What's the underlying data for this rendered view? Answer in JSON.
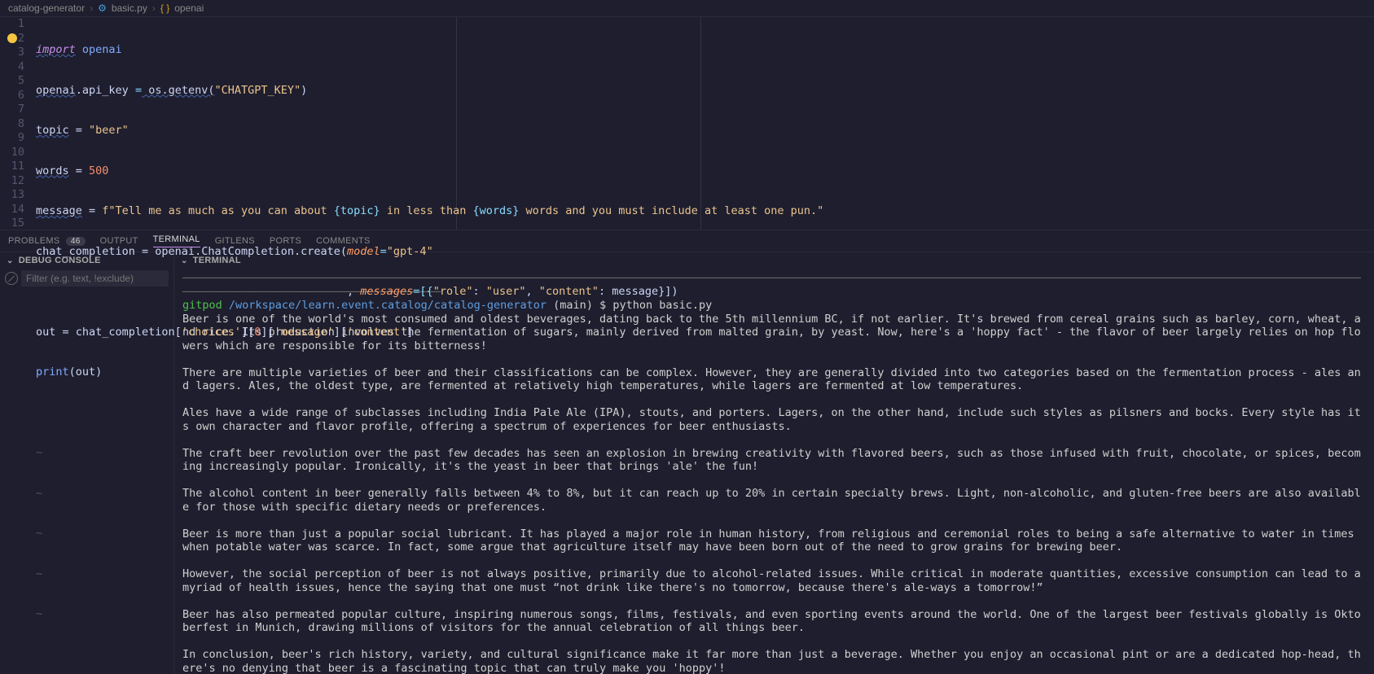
{
  "breadcrumb": {
    "folder": "catalog-generator",
    "file": "basic.py",
    "symbol": "openai"
  },
  "editor": {
    "lines": [
      "1",
      "2",
      "3",
      "4",
      "5",
      "6",
      "7",
      "8",
      "9",
      "10",
      "11",
      "12",
      "13",
      "14",
      "15"
    ],
    "code": {
      "l1_kw": "import",
      "l1_mod": "openai",
      "l2_a": "openai",
      "l2_b": ".api_key ",
      "l2_c": "=",
      "l2_d": " os.getenv(",
      "l2_e": "\"CHATGPT_KEY\"",
      "l2_f": ")",
      "l3_a": "topic",
      "l3_b": " = ",
      "l3_c": "\"beer\"",
      "l4_a": "words",
      "l4_b": " = ",
      "l4_c": "500",
      "l5_a": "message",
      "l5_b": " = ",
      "l5_c": "f\"Tell me as much as you can about ",
      "l5_d": "{topic}",
      "l5_e": " in less than ",
      "l5_f": "{words}",
      "l5_g": " words and you must include at least one pun.\"",
      "l6_a": "chat_completion = openai.ChatCompletion.create(",
      "l6_b": "model",
      "l6_c": "=",
      "l6_d": "\"gpt-4\"",
      "l7_a": "                                               , ",
      "l7_b": "messages",
      "l7_c": "=[{",
      "l7_d": "\"role\"",
      "l7_e": ": ",
      "l7_f": "\"user\"",
      "l7_g": ", ",
      "l7_h": "\"content\"",
      "l7_i": ": message}])",
      "l8": "out = chat_completion['choices'][0]['message']['content']",
      "l8_a": "out = chat_completion[",
      "l8_b": "'choices'",
      "l8_c": "][",
      "l8_d": "0",
      "l8_e": "][",
      "l8_f": "'message'",
      "l8_g": "][",
      "l8_h": "'content'",
      "l8_i": "]",
      "l9_a": "print",
      "l9_b": "(out)",
      "tilde": "~"
    }
  },
  "panel_tabs": {
    "problems": "PROBLEMS",
    "problems_count": "46",
    "output": "OUTPUT",
    "terminal": "TERMINAL",
    "gitlens": "GITLENS",
    "ports": "PORTS",
    "comments": "COMMENTS"
  },
  "debug_console": {
    "title": "DEBUG CONSOLE",
    "filter_placeholder": "Filter (e.g. text, !exclude)"
  },
  "terminal": {
    "title": "TERMINAL",
    "prompt_user": "gitpod",
    "prompt_path": " /workspace/learn.event.catalog/catalog-generator",
    "prompt_branch": " (main) $ ",
    "command": "python basic.py",
    "p1": "Beer is one of the world's most consumed and oldest beverages, dating back to the 5th millennium BC, if not earlier. It's brewed from cereal grains such as barley, corn, wheat, and rice. Its production involves the fermentation of sugars, mainly derived from malted grain, by yeast. Now, here's a 'hoppy fact' - the flavor of beer largely relies on hop flowers which are responsible for its bitterness!",
    "p2": "There are multiple varieties of beer and their classifications can be complex. However, they are generally divided into two categories based on the fermentation process - ales and lagers. Ales, the oldest type, are fermented at relatively high temperatures, while lagers are fermented at low temperatures.",
    "p3": "Ales have a wide range of subclasses including India Pale Ale (IPA), stouts, and porters. Lagers, on the other hand, include such styles as pilsners and bocks. Every style has its own character and flavor profile, offering a spectrum of experiences for beer enthusiasts.",
    "p4": "The craft beer revolution over the past few decades has seen an explosion in brewing creativity with flavored beers, such as those infused with fruit, chocolate, or spices, becoming increasingly popular. Ironically, it's the yeast in beer that brings 'ale' the fun!",
    "p5": "The alcohol content in beer generally falls between 4% to 8%, but it can reach up to 20% in certain specialty brews. Light, non-alcoholic, and gluten-free beers are also available for those with specific dietary needs or preferences.",
    "p6": "Beer is more than just a popular social lubricant. It has played a major role in human history, from religious and ceremonial roles to being a safe alternative to water in times when potable water was scarce. In fact, some argue that agriculture itself may have been born out of the need to grow grains for brewing beer.",
    "p7": "However, the social perception of beer is not always positive, primarily due to alcohol-related issues. While critical in moderate quantities, excessive consumption can lead to a myriad of health issues, hence the saying that one must “not drink like there's no tomorrow, because there's ale-ways a tomorrow!”",
    "p8": "Beer has also permeated popular culture, inspiring numerous songs, films, festivals, and even sporting events around the world. One of the largest beer festivals globally is Oktoberfest in Munich, drawing millions of visitors for the annual celebration of all things beer.",
    "p9": "In conclusion, beer's rich history, variety, and cultural significance make it far more than just a beverage. Whether you enjoy an occasional pint or are a dedicated hop-head, there's no denying that beer is a fascinating topic that can truly make you 'hoppy'!"
  }
}
